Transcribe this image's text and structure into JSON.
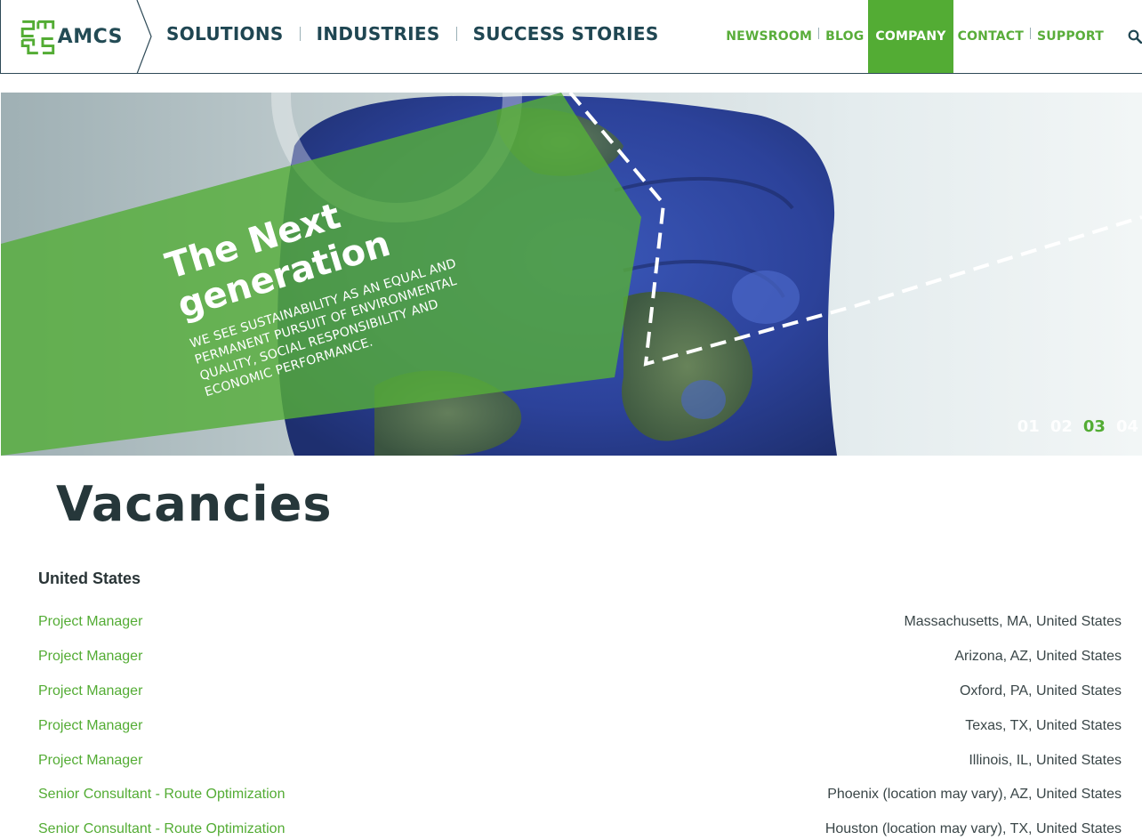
{
  "header": {
    "logo_text": "AMCS",
    "main_nav": [
      "SOLUTIONS",
      "INDUSTRIES",
      "SUCCESS STORIES"
    ],
    "sub_nav": [
      "NEWSROOM",
      "BLOG",
      "COMPANY",
      "CONTACT",
      "SUPPORT"
    ],
    "active_item": "COMPANY",
    "search_icon": "search-icon"
  },
  "hero": {
    "title_line1": "The Next",
    "title_line2": "generation",
    "subtitle": "WE SEE SUSTAINABILITY AS AN EQUAL AND PERMANENT PURSUIT OF ENVIRONMENTAL QUALITY, SOCIAL RESPONSIBILITY AND ECONOMIC PERFORMANCE.",
    "slides": [
      "01",
      "02",
      "03",
      "04"
    ],
    "active_slide": "03"
  },
  "vacancies": {
    "title": "Vacancies",
    "region": "United States",
    "jobs": [
      {
        "title": "Project Manager",
        "location": "Massachusetts, MA, United States"
      },
      {
        "title": "Project Manager",
        "location": "Arizona, AZ, United States"
      },
      {
        "title": "Project Manager",
        "location": "Oxford, PA, United States"
      },
      {
        "title": "Project Manager",
        "location": "Texas, TX, United States"
      },
      {
        "title": "Project Manager",
        "location": "Illinois, IL, United States"
      },
      {
        "title": "Senior Consultant - Route Optimization",
        "location": "Phoenix (location may vary), AZ, United States"
      },
      {
        "title": "Senior Consultant - Route Optimization",
        "location": "Houston (location may vary), TX, United States"
      }
    ]
  },
  "colors": {
    "brand_green": "#53ac34",
    "navy": "#1f4652"
  }
}
